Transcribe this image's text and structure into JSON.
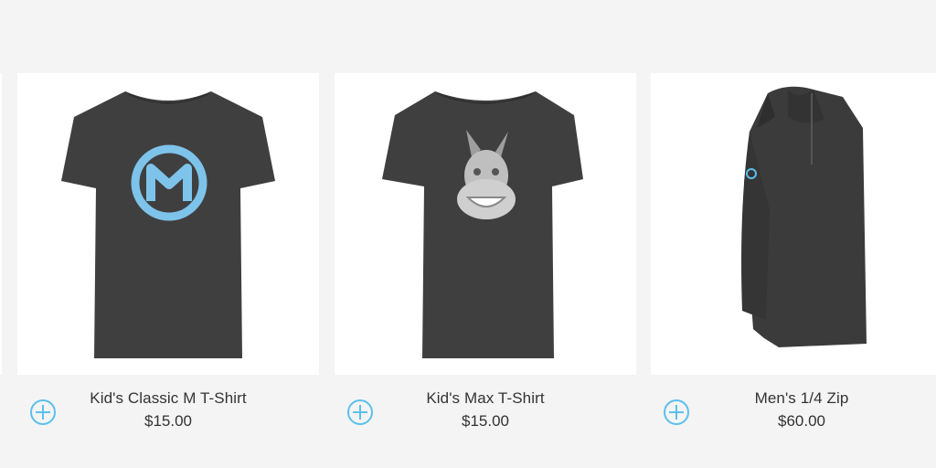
{
  "colors": {
    "page_background": "#f4f4f4",
    "card_background": "#ffffff",
    "accent": "#5bc0eb",
    "shirt": "#3f3f40",
    "text": "#333333"
  },
  "products": [
    {
      "name": "Kid's Classic M T-Shirt",
      "price": "$15.00",
      "image": "dark-tshirt-m-logo",
      "action_icon": "plus-circle-icon"
    },
    {
      "name": "Kid's Max T-Shirt",
      "price": "$15.00",
      "image": "dark-tshirt-donkey-mascot",
      "action_icon": "plus-circle-icon"
    },
    {
      "name": "Men's 1/4 Zip",
      "price": "$60.00",
      "image": "dark-quarter-zip-pullover",
      "action_icon": "plus-circle-icon"
    }
  ]
}
